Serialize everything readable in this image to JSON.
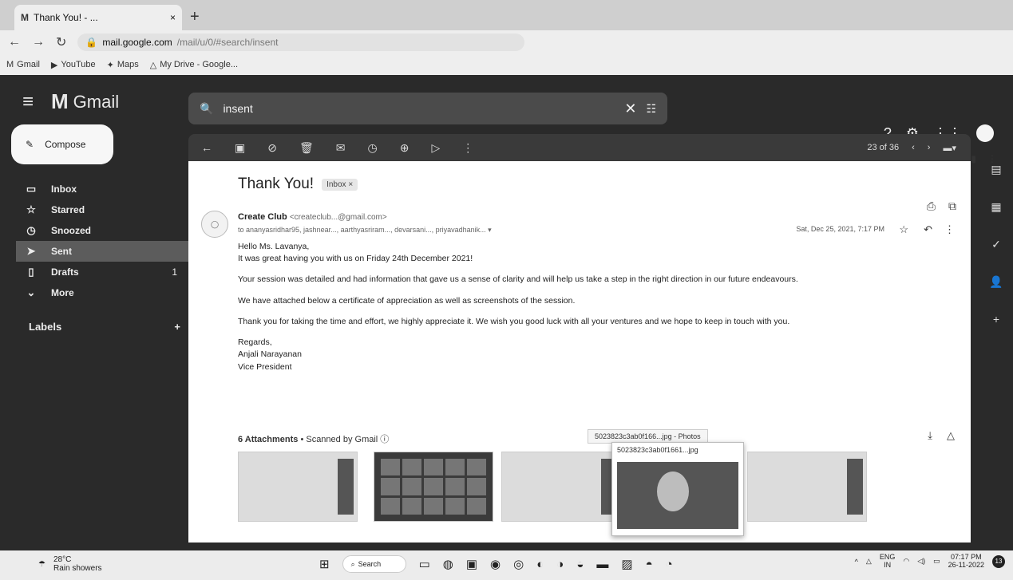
{
  "browser": {
    "tab_title": "Thank You! - ...",
    "tab_close": "×",
    "new_tab": "+",
    "url_host": "mail.google.com",
    "url_path": "/mail/u/0/#search/insent",
    "bookmarks": [
      {
        "icon": "M",
        "label": "Gmail"
      },
      {
        "icon": "▶",
        "label": "YouTube"
      },
      {
        "icon": "✦",
        "label": "Maps"
      },
      {
        "icon": "△",
        "label": "My Drive - Google..."
      }
    ],
    "window_controls": [
      "⌄",
      "–",
      "□",
      "×"
    ]
  },
  "gmail": {
    "logo_text": "Gmail",
    "search_query": "insent",
    "compose_label": "Compose",
    "nav": [
      {
        "icon": "▭",
        "label": "Inbox",
        "count": ""
      },
      {
        "icon": "☆",
        "label": "Starred",
        "count": ""
      },
      {
        "icon": "◷",
        "label": "Snoozed",
        "count": ""
      },
      {
        "icon": "➤",
        "label": "Sent",
        "count": ""
      },
      {
        "icon": "▯",
        "label": "Drafts",
        "count": "1"
      },
      {
        "icon": "⌄",
        "label": "More",
        "count": ""
      }
    ],
    "labels_heading": "Labels",
    "labels_add": "+",
    "pager_text": "23 of 36"
  },
  "email": {
    "subject": "Thank You!",
    "inbox_chip": "Inbox ×",
    "sender_name": "Create Club",
    "sender_email": "<createclub...@gmail.com>",
    "recipients": "to ananyasridhar95, jashnear..., aarthyasriram..., devarsani..., priyavadhanik... ▾",
    "date": "Sat, Dec 25, 2021, 7:17 PM",
    "body": [
      "Hello Ms. Lavanya,",
      "It was great having you with us on Friday 24th December 2021!",
      "Your session was detailed and had information that gave us a sense of clarity and will help us take a step in the right direction in our future endeavours.",
      "We have attached below a certificate of appreciation as well as screenshots of the session.",
      "Thank you for taking the time and effort, we highly appreciate it. We wish you good luck with all your ventures and we hope to keep in touch with you."
    ],
    "closing": [
      "Regards,",
      "Anjali Narayanan",
      "Vice President"
    ],
    "attachments_count": "6 Attachments",
    "attachments_scanned": " • Scanned by Gmail ⓘ",
    "attachment_tooltip": "5023823c3ab0f166...jpg - Photos",
    "hover_caption": "5023823c3ab0f1661...jpg"
  },
  "taskbar": {
    "temp": "28°C",
    "weather": "Rain showers",
    "search": "Search",
    "lang_top": "ENG",
    "lang_bottom": "IN",
    "time": "07:17 PM",
    "date": "26-11-2022",
    "notif_count": "13"
  }
}
